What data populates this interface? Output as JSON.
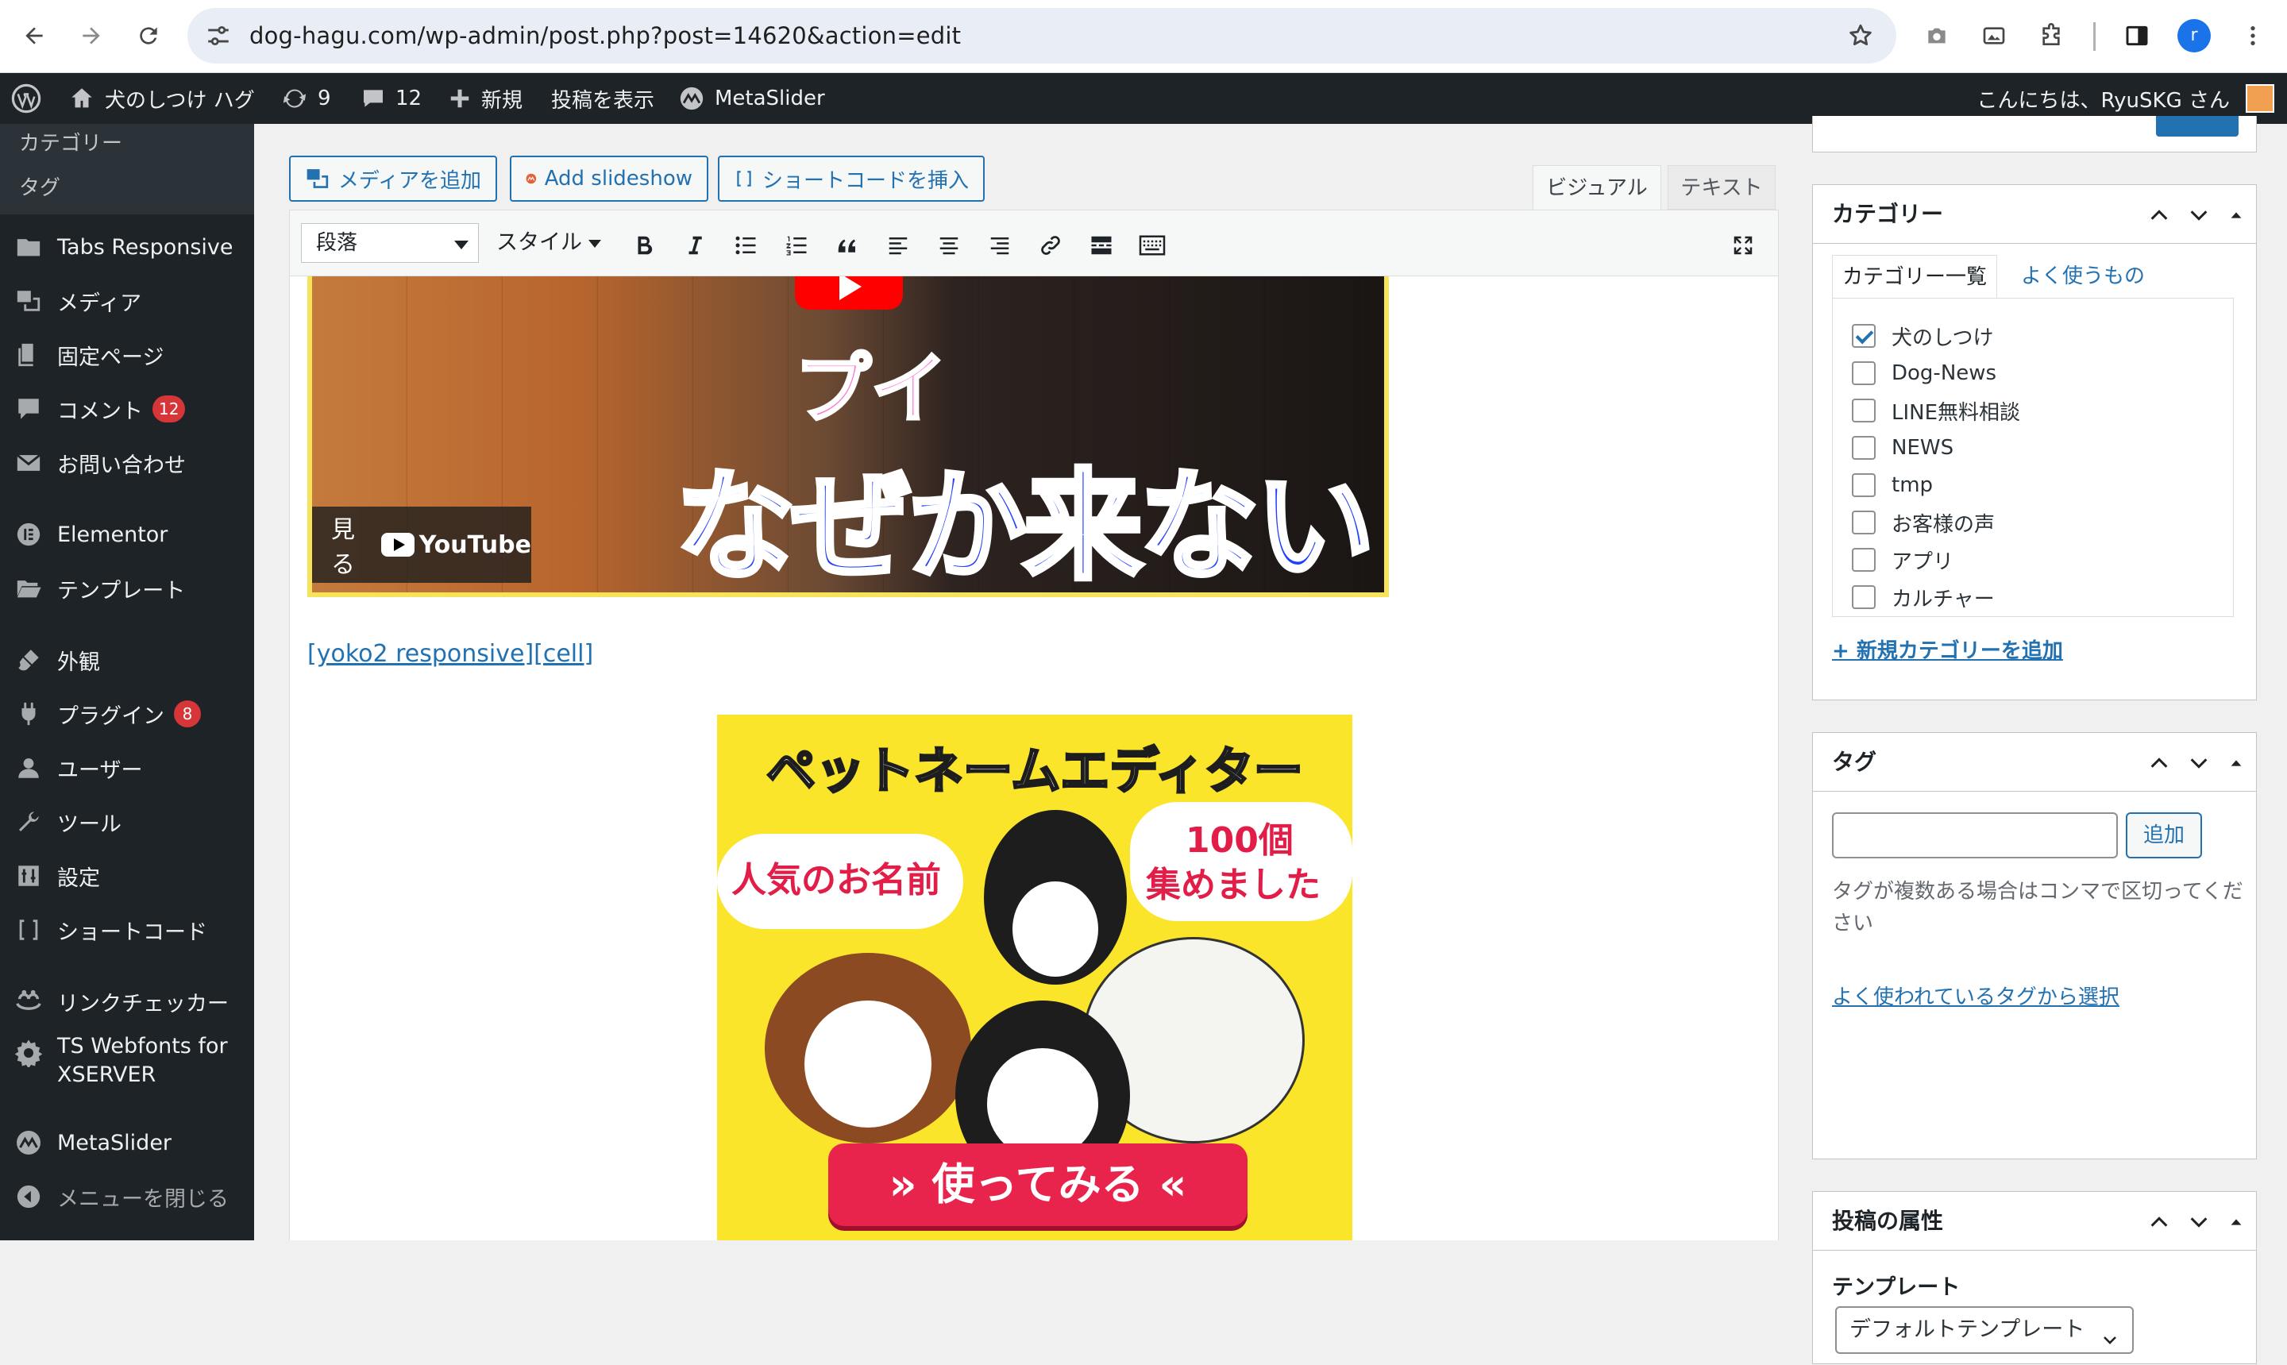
{
  "browser": {
    "url": "dog-hagu.com/wp-admin/post.php?post=14620&action=edit",
    "profile_initial": "r"
  },
  "adminbar": {
    "site_name": "犬のしつけ ハグ",
    "updates_count": "9",
    "comments_count": "12",
    "new_label": "新規",
    "view_post_label": "投稿を表示",
    "metaslider_label": "MetaSlider",
    "greeting": "こんにちは、RyuSKG さん"
  },
  "sidebar": {
    "sub_items": [
      "カテゴリー",
      "タグ"
    ],
    "items": [
      {
        "label": "Tabs Responsive",
        "icon": "folder-icon"
      },
      {
        "label": "メディア",
        "icon": "media-icon"
      },
      {
        "label": "固定ページ",
        "icon": "page-icon"
      },
      {
        "label": "コメント",
        "icon": "comment-icon",
        "badge": "12"
      },
      {
        "label": "お問い合わせ",
        "icon": "mail-icon"
      },
      {
        "label": "Elementor",
        "icon": "elementor-icon"
      },
      {
        "label": "テンプレート",
        "icon": "folder-open-icon"
      },
      {
        "label": "外観",
        "icon": "brush-icon"
      },
      {
        "label": "プラグイン",
        "icon": "plugin-icon",
        "badge": "8"
      },
      {
        "label": "ユーザー",
        "icon": "user-icon"
      },
      {
        "label": "ツール",
        "icon": "wrench-icon"
      },
      {
        "label": "設定",
        "icon": "settings-icon"
      },
      {
        "label": "ショートコード",
        "icon": "brackets-icon"
      },
      {
        "label": "リンクチェッカー",
        "icon": "link-checker-icon"
      },
      {
        "label": "TS Webfonts for",
        "label2": "XSERVER",
        "icon": "gear-icon"
      },
      {
        "label": "MetaSlider",
        "icon": "metaslider-icon"
      },
      {
        "label": "メニューを閉じる",
        "icon": "collapse-icon"
      }
    ]
  },
  "editor": {
    "add_media": "メディアを追加",
    "add_slideshow": "Add slideshow",
    "insert_shortcode": "ショートコードを挿入",
    "tab_visual": "ビジュアル",
    "tab_text": "テキスト",
    "format_select": "段落",
    "style_dropdown": "スタイル",
    "video": {
      "overlay_small": "プイ",
      "overlay_big": "なぜか来ない!",
      "watch_label": "見る",
      "youtube_label": "YouTube"
    },
    "shortcode_text": "[yoko2 responsive][cell]",
    "banner": {
      "title": "ペットネームエディター",
      "left_bubble": "人気のお名前",
      "right_bubble_1": "100個",
      "right_bubble_2": "集めました",
      "cta": "使ってみる"
    }
  },
  "categories": {
    "title": "カテゴリー",
    "tab_all": "カテゴリー一覧",
    "tab_popular": "よく使うもの",
    "items": [
      {
        "label": "犬のしつけ",
        "checked": true
      },
      {
        "label": "Dog-News",
        "checked": false
      },
      {
        "label": "LINE無料相談",
        "checked": false
      },
      {
        "label": "NEWS",
        "checked": false
      },
      {
        "label": "tmp",
        "checked": false
      },
      {
        "label": "お客様の声",
        "checked": false
      },
      {
        "label": "アプリ",
        "checked": false
      },
      {
        "label": "カルチャー",
        "checked": false
      }
    ],
    "add_new": "+ 新規カテゴリーを追加"
  },
  "tags": {
    "title": "タグ",
    "add_button": "追加",
    "help": "タグが複数ある場合はコンマで区切ってください",
    "choose_link": "よく使われているタグから選択"
  },
  "attributes": {
    "title": "投稿の属性",
    "template_label": "テンプレート",
    "template_value": "デフォルトテンプレート"
  },
  "colors": {
    "admin_dark": "#1d2327",
    "link_blue": "#2271b1",
    "badge_red": "#d63638"
  }
}
